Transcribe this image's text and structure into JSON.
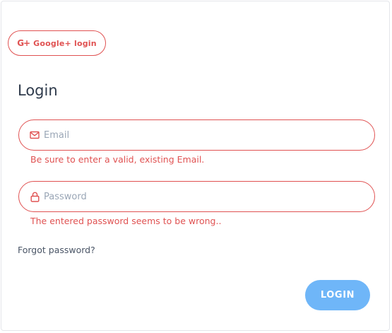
{
  "social": {
    "google_icon": "G+",
    "google_label": "Google+ login"
  },
  "form": {
    "title": "Login",
    "email": {
      "placeholder": "Email",
      "value": "",
      "icon": "envelope-icon",
      "error": "Be sure to enter a valid, existing Email."
    },
    "password": {
      "placeholder": "Password",
      "value": "",
      "icon": "lock-icon",
      "error": "The entered password seems to be wrong.."
    },
    "forgot_label": "Forgot password?",
    "submit_label": "LOGIN"
  },
  "colors": {
    "error": "#e05252",
    "primary_button": "#6fb6f8",
    "title": "#2f3b4c",
    "placeholder": "#9aa6b6"
  }
}
